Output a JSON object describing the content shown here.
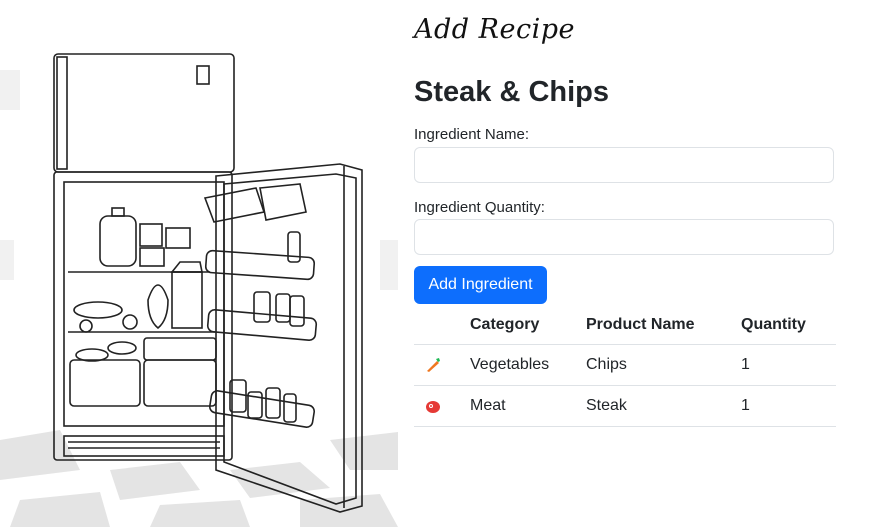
{
  "page": {
    "brand": "Add Recipe",
    "recipe_title": "Steak & Chips"
  },
  "form": {
    "name_label": "Ingredient Name:",
    "name_value": "",
    "quantity_label": "Ingredient Quantity:",
    "quantity_value": "",
    "add_button": "Add Ingredient"
  },
  "table": {
    "headers": {
      "icon": "",
      "category": "Category",
      "product": "Product Name",
      "quantity": "Quantity"
    },
    "rows": [
      {
        "icon": "carrot-icon",
        "category": "Vegetables",
        "product": "Chips",
        "quantity": "1"
      },
      {
        "icon": "meat-icon",
        "category": "Meat",
        "product": "Steak",
        "quantity": "1"
      }
    ]
  },
  "colors": {
    "primary": "#0d6efd",
    "border": "#dee2e6",
    "text": "#212529"
  }
}
